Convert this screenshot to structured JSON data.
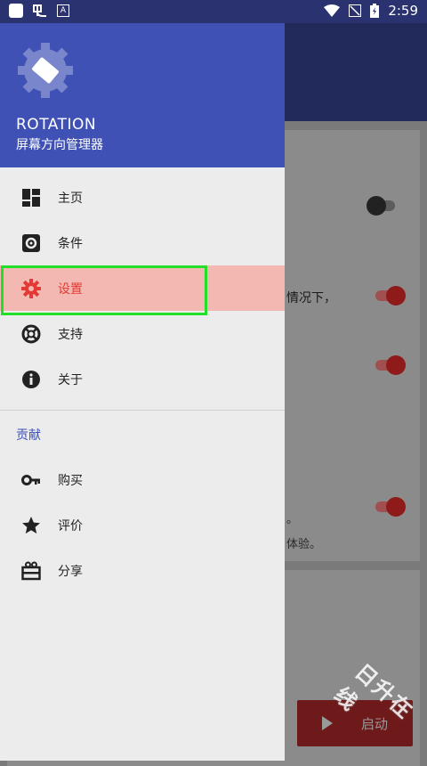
{
  "status_bar": {
    "time": "2:59"
  },
  "drawer": {
    "app_title": "ROTATION",
    "app_subtitle": "屏幕方向管理器",
    "items": [
      {
        "label": "主页",
        "icon": "dashboard-icon"
      },
      {
        "label": "条件",
        "icon": "conditions-icon"
      },
      {
        "label": "设置",
        "icon": "settings-gear-icon",
        "active": true
      },
      {
        "label": "支持",
        "icon": "lifebuoy-icon"
      },
      {
        "label": "关于",
        "icon": "info-icon"
      }
    ],
    "section_title": "贡献",
    "contrib_items": [
      {
        "label": "购买",
        "icon": "key-icon"
      },
      {
        "label": "评价",
        "icon": "star-icon"
      },
      {
        "label": "分享",
        "icon": "gift-share-icon"
      }
    ]
  },
  "background": {
    "text1": "情况下，",
    "text2": "。",
    "text3": "体验。",
    "fab_label": "启动"
  },
  "watermark": "日升在线",
  "colors": {
    "primary": "#3f51b5",
    "accent": "#e53935",
    "highlight": "#22e02a"
  }
}
